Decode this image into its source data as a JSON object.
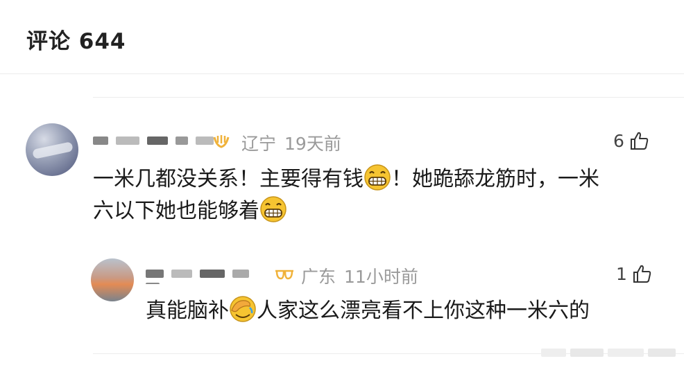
{
  "header": {
    "title": "评论 644"
  },
  "comments": [
    {
      "location": "辽宁",
      "time": "19天前",
      "likes": "6",
      "text_line1_a": "一米几都没关系！主要得有钱",
      "text_line1_b": "！她跪舔龙筋时，一米",
      "text_line2_a": "六以下她也能够着",
      "emoji": "grin-emoji"
    },
    {
      "location": "广东",
      "time": "11小时前",
      "likes": "1",
      "text_a": "真能脑补",
      "text_b": "人家这么漂亮看不上你这种一米六的",
      "emoji": "facepalm-emoji"
    }
  ],
  "colors": {
    "meta": "#9a9a9a",
    "text": "#1a1a1a",
    "emoji_yellow": "#f6c431"
  }
}
